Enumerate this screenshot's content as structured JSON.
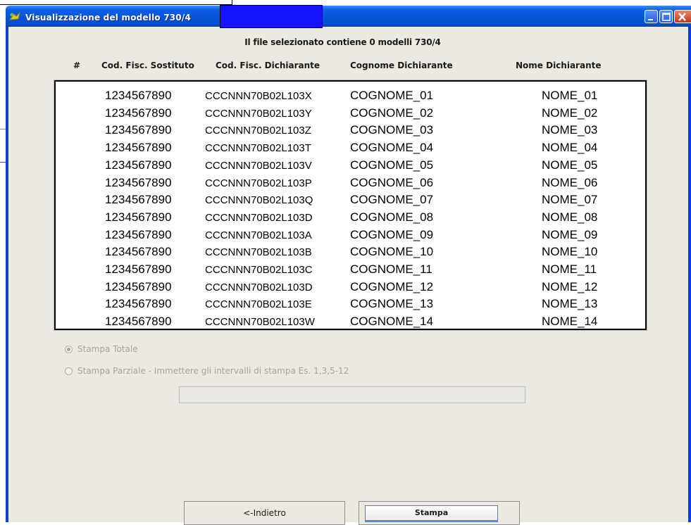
{
  "window": {
    "title": "Visualizzazione del modello 730/4",
    "controls": {
      "minimize_icon": "minimize-icon",
      "maximize_icon": "maximize-icon",
      "close_icon": "close-icon"
    }
  },
  "info": {
    "text": "Il file selezionato contiene 0 modelli 730/4"
  },
  "columns": {
    "num": "#",
    "cf_sostituto": "Cod. Fisc. Sostituto",
    "cf_dichiarante": "Cod. Fisc. Dichiarante",
    "cognome": "Cognome Dichiarante",
    "nome": "Nome Dichiarante"
  },
  "rows": [
    {
      "cf_sostituto": "1234567890",
      "cf_dichiarante": "CCCNNN70B02L103X",
      "cognome": "COGNOME_01",
      "nome": "NOME_01"
    },
    {
      "cf_sostituto": "1234567890",
      "cf_dichiarante": "CCCNNN70B02L103Y",
      "cognome": "COGNOME_02",
      "nome": "NOME_02"
    },
    {
      "cf_sostituto": "1234567890",
      "cf_dichiarante": "CCCNNN70B02L103Z",
      "cognome": "COGNOME_03",
      "nome": "NOME_03"
    },
    {
      "cf_sostituto": "1234567890",
      "cf_dichiarante": "CCCNNN70B02L103T",
      "cognome": "COGNOME_04",
      "nome": "NOME_04"
    },
    {
      "cf_sostituto": "1234567890",
      "cf_dichiarante": "CCCNNN70B02L103V",
      "cognome": "COGNOME_05",
      "nome": "NOME_05"
    },
    {
      "cf_sostituto": "1234567890",
      "cf_dichiarante": "CCCNNN70B02L103P",
      "cognome": "COGNOME_06",
      "nome": "NOME_06"
    },
    {
      "cf_sostituto": "1234567890",
      "cf_dichiarante": "CCCNNN70B02L103Q",
      "cognome": "COGNOME_07",
      "nome": "NOME_07"
    },
    {
      "cf_sostituto": "1234567890",
      "cf_dichiarante": "CCCNNN70B02L103D",
      "cognome": "COGNOME_08",
      "nome": "NOME_08"
    },
    {
      "cf_sostituto": "1234567890",
      "cf_dichiarante": "CCCNNN70B02L103A",
      "cognome": "COGNOME_09",
      "nome": "NOME_09"
    },
    {
      "cf_sostituto": "1234567890",
      "cf_dichiarante": "CCCNNN70B02L103B",
      "cognome": "COGNOME_10",
      "nome": "NOME_10"
    },
    {
      "cf_sostituto": "1234567890",
      "cf_dichiarante": "CCCNNN70B02L103C",
      "cognome": "COGNOME_11",
      "nome": "NOME_11"
    },
    {
      "cf_sostituto": "1234567890",
      "cf_dichiarante": "CCCNNN70B02L103D",
      "cognome": "COGNOME_12",
      "nome": "NOME_12"
    },
    {
      "cf_sostituto": "1234567890",
      "cf_dichiarante": "CCCNNN70B02L103E",
      "cognome": "COGNOME_13",
      "nome": "NOME_13"
    },
    {
      "cf_sostituto": "1234567890",
      "cf_dichiarante": "CCCNNN70B02L103W",
      "cognome": "COGNOME_14",
      "nome": "NOME_14"
    }
  ],
  "options": {
    "totale": {
      "label": "Stampa Totale",
      "selected": true
    },
    "parziale": {
      "label": "Stampa Parziale - Immettere gli intervalli di stampa  Es. 1,3,5-12",
      "selected": false
    },
    "range_value": ""
  },
  "buttons": {
    "back": "<-Indietro",
    "print": "Stampa"
  },
  "colors": {
    "titlebar": "#0853d7",
    "window_bg": "#ebe9e0",
    "disabled_text": "#a6a39a",
    "focus_underline": "#4a90e2"
  }
}
